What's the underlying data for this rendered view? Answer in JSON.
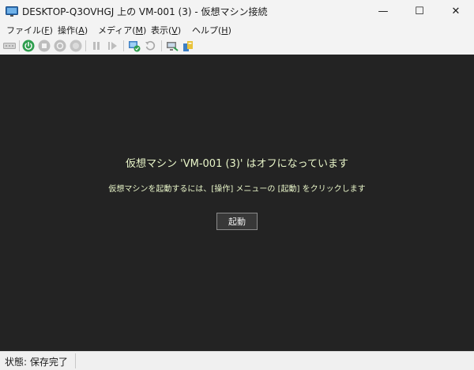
{
  "window": {
    "title": "DESKTOP-Q3OVHGJ 上の VM-001 (3)  - 仮想マシン接続",
    "minimize_glyph": "—",
    "maximize_glyph": "☐",
    "close_glyph": "✕"
  },
  "menu": {
    "items": [
      {
        "label": "ファイル(",
        "key": "F",
        "suffix": ")"
      },
      {
        "label": "操作(",
        "key": "A",
        "suffix": ")"
      },
      {
        "label": "メディア(",
        "key": "M",
        "suffix": ")"
      },
      {
        "label": "表示(",
        "key": "V",
        "suffix": ")"
      },
      {
        "label": "ヘルプ(",
        "key": "H",
        "suffix": ")"
      }
    ]
  },
  "toolbar": {
    "icons": [
      "ctrl-alt-del-icon",
      "start-icon",
      "turn-off-icon",
      "shutdown-icon",
      "save-icon",
      "pause-icon",
      "resume-icon",
      "checkpoint-icon",
      "revert-icon",
      "enhanced-session-icon",
      "share-icon"
    ]
  },
  "console": {
    "message": "仮想マシン 'VM-001 (3)' はオフになっています",
    "instruction": "仮想マシンを起動するには、[操作] メニューの [起動] をクリックします",
    "start_label": "起動",
    "text_color": "#e8f5c8",
    "background": "#232323"
  },
  "status": {
    "text": "状態: 保存完了"
  },
  "colors": {
    "accent_green": "#2e9e4e",
    "disabled_gray": "#a8a8a8"
  }
}
